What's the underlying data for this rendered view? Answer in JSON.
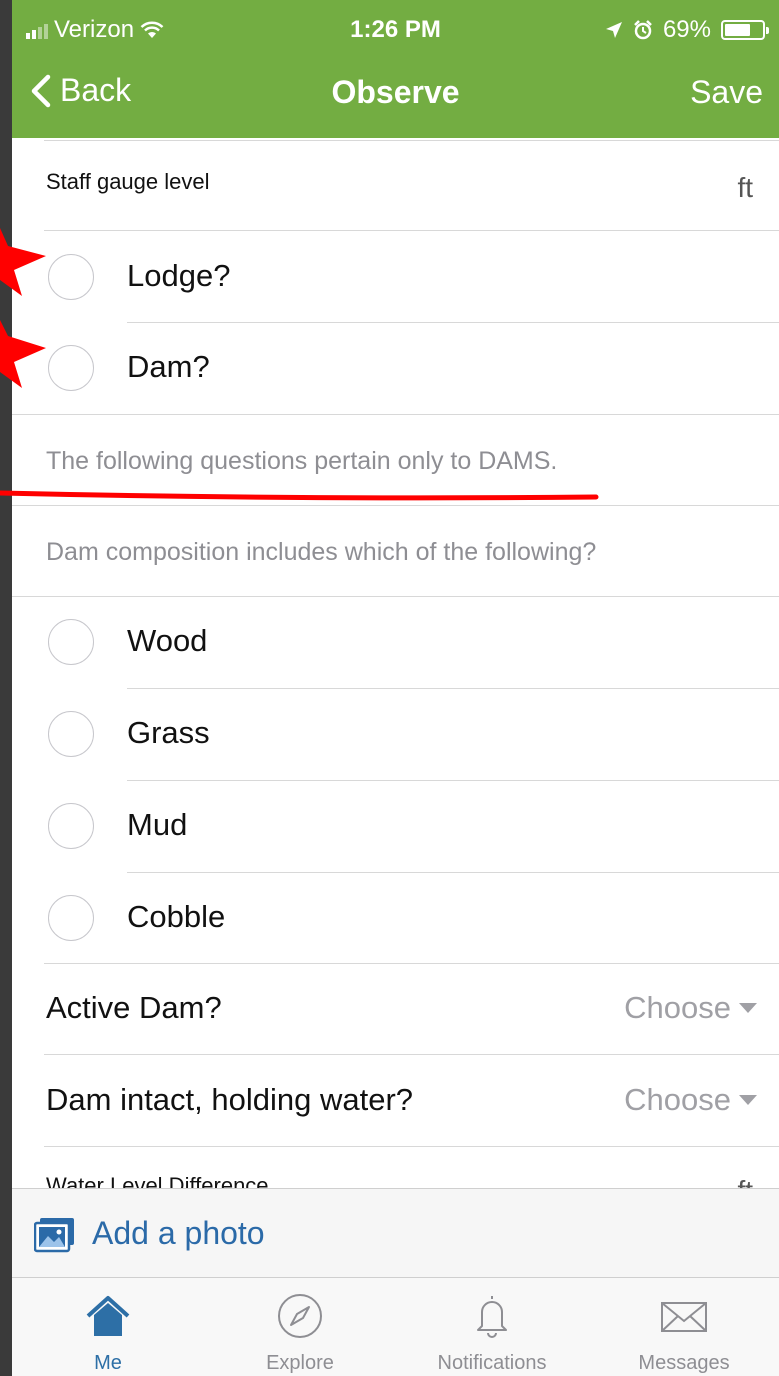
{
  "status_bar": {
    "carrier": "Verizon",
    "time": "1:26 PM",
    "battery": "69%",
    "battery_level": 0.69
  },
  "nav": {
    "back_label": "Back",
    "title": "Observe",
    "save_label": "Save"
  },
  "form": {
    "staff_gauge": {
      "label": "Staff gauge level",
      "unit": "ft"
    },
    "lodge": {
      "label": "Lodge?"
    },
    "dam": {
      "label": "Dam?"
    },
    "dams_note": "The following questions pertain only to DAMS.",
    "composition_prompt": "Dam composition includes which of the following?",
    "composition_options": [
      "Wood",
      "Grass",
      "Mud",
      "Cobble"
    ],
    "active_dam": {
      "label": "Active Dam?",
      "value": "Choose"
    },
    "dam_intact": {
      "label": "Dam intact, holding water?",
      "value": "Choose"
    },
    "water_level_difference": {
      "label": "Water Level Difference",
      "unit": "ft"
    }
  },
  "photo": {
    "label": "Add a photo"
  },
  "tabs": [
    {
      "label": "Me",
      "icon": "home-icon"
    },
    {
      "label": "Explore",
      "icon": "compass-icon"
    },
    {
      "label": "Notifications",
      "icon": "bell-icon"
    },
    {
      "label": "Messages",
      "icon": "envelope-icon"
    }
  ],
  "colors": {
    "header": "#73ad42",
    "accent_blue": "#2d6fa6",
    "annotation_red": "#ff0000"
  }
}
